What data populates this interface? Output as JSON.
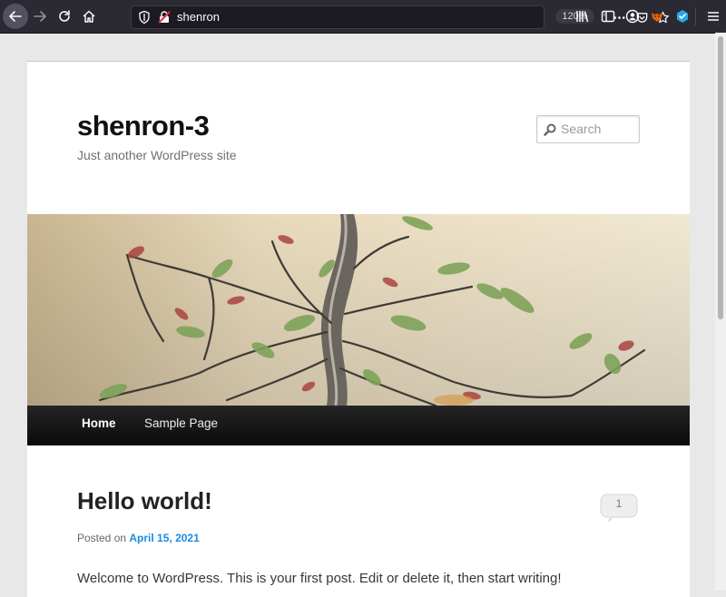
{
  "browser": {
    "url": "shenron",
    "zoom": "120%",
    "icons": [
      "back-icon",
      "forward-icon",
      "reload-icon",
      "home-icon",
      "tracking-shield-icon",
      "insecure-lock-icon",
      "more-actions-icon",
      "pocket-icon",
      "bookmark-star-icon",
      "library-icon",
      "sidebar-icon",
      "account-icon",
      "extension-fox-icon",
      "extension-cube-icon",
      "hamburger-menu-icon"
    ]
  },
  "site": {
    "title": "shenron-3",
    "description": "Just another WordPress site",
    "search_placeholder": "Search"
  },
  "nav": {
    "home": "Home",
    "sample": "Sample Page"
  },
  "post": {
    "title": "Hello world!",
    "comment_count": "1",
    "posted_on_label": "Posted on",
    "date": "April 15, 2021",
    "content": "Welcome to WordPress. This is your first post. Edit or delete it, then start writing!"
  },
  "colors": {
    "link": "#1b8be0",
    "toolbar": "#2b2a33",
    "nav_bar": "#111111"
  }
}
